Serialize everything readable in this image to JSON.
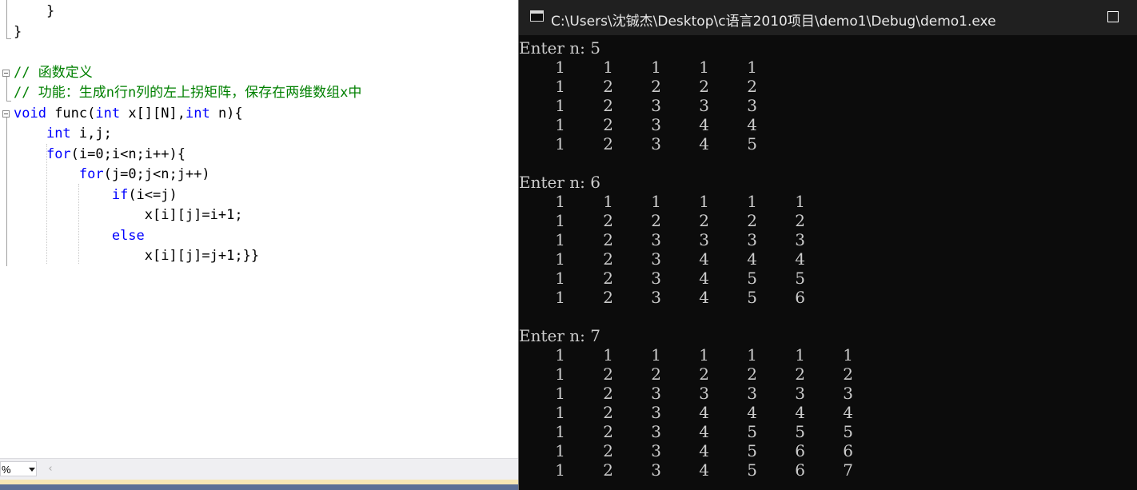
{
  "editor": {
    "code_lines": [
      {
        "indent": "    ",
        "segments": [
          {
            "t": "}",
            "c": ""
          }
        ]
      },
      {
        "indent": "",
        "segments": [
          {
            "t": "}",
            "c": ""
          }
        ]
      },
      {
        "indent": "",
        "segments": []
      },
      {
        "indent": "",
        "segments": [
          {
            "t": "// 函数定义",
            "c": "cm"
          }
        ]
      },
      {
        "indent": "",
        "segments": [
          {
            "t": "// 功能：生成n行n列的左上拐矩阵，保存在两维数组x中",
            "c": "cm"
          }
        ]
      },
      {
        "indent": "",
        "segments": [
          {
            "t": "void",
            "c": "kw"
          },
          {
            "t": " func(",
            "c": ""
          },
          {
            "t": "int",
            "c": "kw"
          },
          {
            "t": " x[][N],",
            "c": ""
          },
          {
            "t": "int",
            "c": "kw"
          },
          {
            "t": " n){",
            "c": ""
          }
        ]
      },
      {
        "indent": "    ",
        "segments": [
          {
            "t": "int",
            "c": "kw"
          },
          {
            "t": " i,j;",
            "c": ""
          }
        ]
      },
      {
        "indent": "    ",
        "segments": [
          {
            "t": "for",
            "c": "kw"
          },
          {
            "t": "(i=0;i<n;i++){",
            "c": ""
          }
        ]
      },
      {
        "indent": "        ",
        "segments": [
          {
            "t": "for",
            "c": "kw"
          },
          {
            "t": "(j=0;j<n;j++)",
            "c": ""
          }
        ]
      },
      {
        "indent": "            ",
        "segments": [
          {
            "t": "if",
            "c": "kw"
          },
          {
            "t": "(i<=j)",
            "c": ""
          }
        ]
      },
      {
        "indent": "                ",
        "segments": [
          {
            "t": "x[i][j]=i+1;",
            "c": ""
          }
        ]
      },
      {
        "indent": "            ",
        "segments": [
          {
            "t": "else",
            "c": "kw"
          }
        ]
      },
      {
        "indent": "                ",
        "segments": [
          {
            "t": "x[i][j]=j+1;}}",
            "c": ""
          }
        ]
      }
    ],
    "zoom_label": "%",
    "scroll_left_glyph": "‹"
  },
  "console": {
    "title": "C:\\Users\\沈铖杰\\Desktop\\c语言2010项目\\demo1\\Debug\\demo1.exe",
    "runs": [
      {
        "prompt": "Enter n: 5",
        "matrix": [
          [
            1,
            1,
            1,
            1,
            1
          ],
          [
            1,
            2,
            2,
            2,
            2
          ],
          [
            1,
            2,
            3,
            3,
            3
          ],
          [
            1,
            2,
            3,
            4,
            4
          ],
          [
            1,
            2,
            3,
            4,
            5
          ]
        ]
      },
      {
        "prompt": "Enter n: 6",
        "matrix": [
          [
            1,
            1,
            1,
            1,
            1,
            1
          ],
          [
            1,
            2,
            2,
            2,
            2,
            2
          ],
          [
            1,
            2,
            3,
            3,
            3,
            3
          ],
          [
            1,
            2,
            3,
            4,
            4,
            4
          ],
          [
            1,
            2,
            3,
            4,
            5,
            5
          ],
          [
            1,
            2,
            3,
            4,
            5,
            6
          ]
        ]
      },
      {
        "prompt": "Enter n: 7",
        "matrix": [
          [
            1,
            1,
            1,
            1,
            1,
            1,
            1
          ],
          [
            1,
            2,
            2,
            2,
            2,
            2,
            2
          ],
          [
            1,
            2,
            3,
            3,
            3,
            3,
            3
          ],
          [
            1,
            2,
            3,
            4,
            4,
            4,
            4
          ],
          [
            1,
            2,
            3,
            4,
            5,
            5,
            5
          ],
          [
            1,
            2,
            3,
            4,
            5,
            6,
            6
          ],
          [
            1,
            2,
            3,
            4,
            5,
            6,
            7
          ]
        ]
      }
    ]
  },
  "icons": {
    "console_app": "console-window-icon",
    "maximize": "maximize-icon",
    "zoom_dropdown": "chevron-down-icon",
    "scroll_left": "scroll-left-icon",
    "fold": "collapse-icon"
  }
}
